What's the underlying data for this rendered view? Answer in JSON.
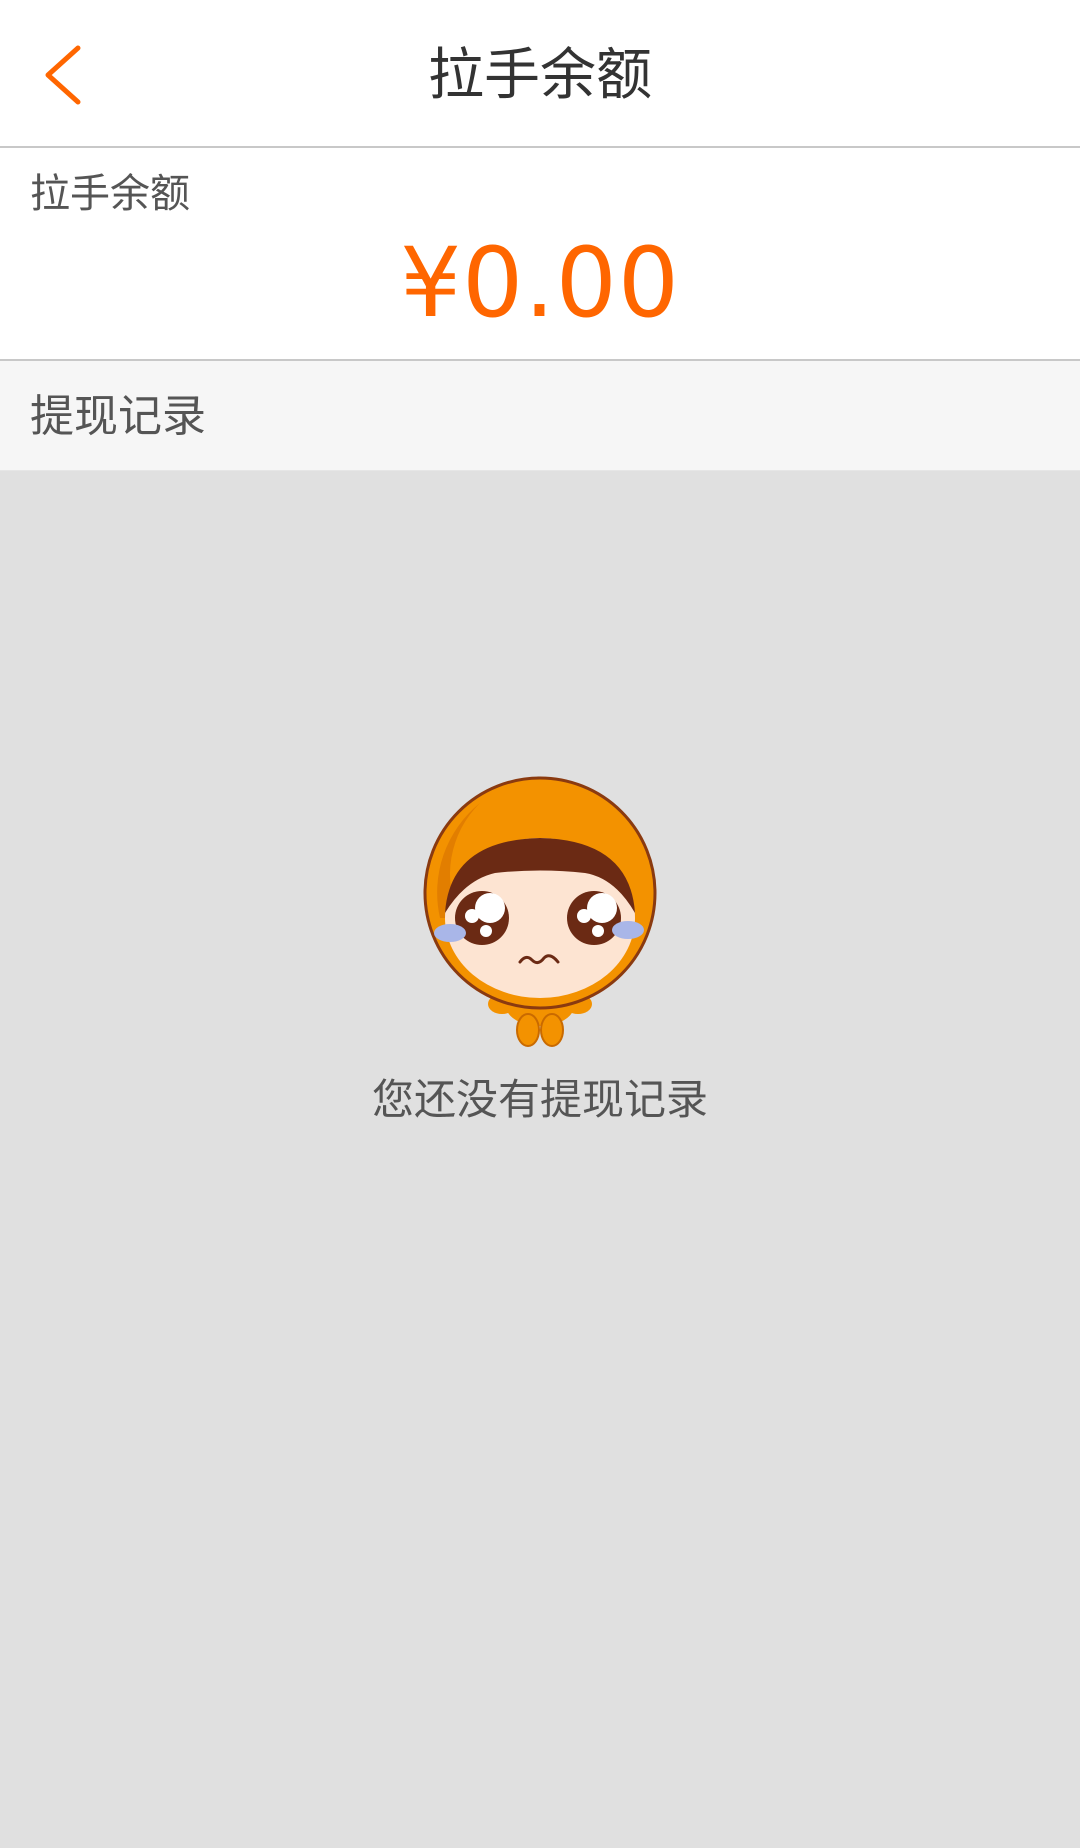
{
  "header": {
    "title": "拉手余额",
    "back_icon": "chevron-left-icon",
    "accent_color": "#ff6600"
  },
  "balance": {
    "label": "拉手余额",
    "amount": "¥0.00",
    "amount_color": "#ff6600"
  },
  "records": {
    "section_title": "提现记录",
    "empty_message": "您还没有提现记录",
    "empty_icon": "crying-mascot-illustration"
  }
}
